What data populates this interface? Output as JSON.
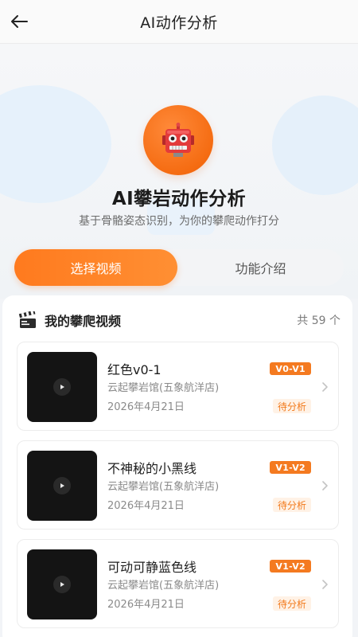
{
  "header": {
    "title": "AI动作分析",
    "back_icon": "arrow-left-icon"
  },
  "hero": {
    "title": "AI攀岩动作分析",
    "subtitle": "基于骨骼姿态识别，为你的攀爬动作打分",
    "icon": "robot-icon",
    "accent_color": "#f56c12"
  },
  "tabs": [
    {
      "label": "选择视频",
      "active": true
    },
    {
      "label": "功能介绍",
      "active": false
    }
  ],
  "panel": {
    "title": "我的攀爬视频",
    "count_text": "共 59 个",
    "icon": "clapperboard-icon"
  },
  "videos": [
    {
      "title": "红色v0-1",
      "gym": "云起攀岩馆(五象航洋店)",
      "date": "2026年4月21日",
      "grade": "V0-V1",
      "status": "待分析"
    },
    {
      "title": "不神秘的小黑线",
      "gym": "云起攀岩馆(五象航洋店)",
      "date": "2026年4月21日",
      "grade": "V1-V2",
      "status": "待分析"
    },
    {
      "title": "可动可静蓝色线",
      "gym": "云起攀岩馆(五象航洋店)",
      "date": "2026年4月21日",
      "grade": "V1-V2",
      "status": "待分析"
    }
  ],
  "colors": {
    "brand_orange": "#ff7a1e",
    "badge_orange": "#f47a20",
    "status_bg": "#fff2e6"
  }
}
